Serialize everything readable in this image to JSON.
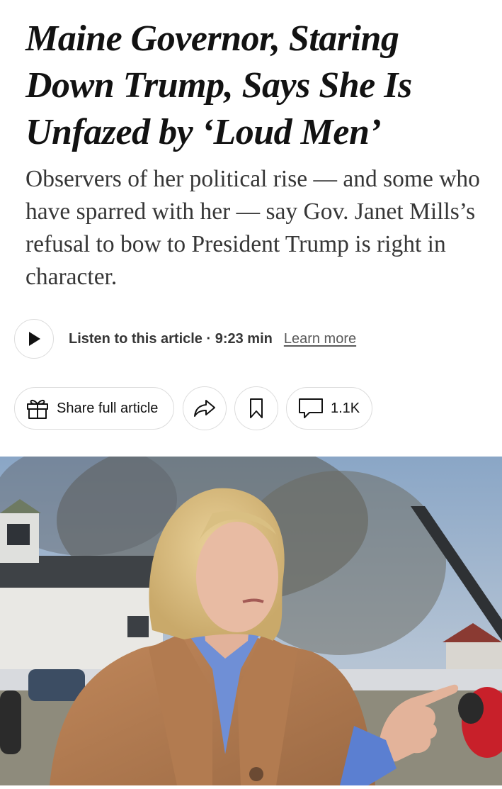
{
  "article": {
    "headline": "Maine Governor, Staring Down Trump, Says She Is Unfazed by ‘Loud Men’",
    "summary": "Observers of her political rise — and some who have sparred with her — say Gov. Janet Mills’s refusal to bow to President Trump is right in character."
  },
  "audio": {
    "play_icon": "play-icon",
    "listen_label": "Listen to this article · 9:23 min",
    "learn_more": "Learn more"
  },
  "actions": {
    "share_icon": "gift-icon",
    "share_label": "Share full article",
    "forward_icon": "share-arrow-icon",
    "save_icon": "bookmark-icon",
    "comments_icon": "comment-icon",
    "comments_count": "1.1K"
  },
  "photo": {
    "subject": "photo of Gov. Janet Mills speaking outdoors"
  },
  "colors": {
    "text": "#121212",
    "summary_text": "#363636",
    "border": "#dcdcdc"
  }
}
